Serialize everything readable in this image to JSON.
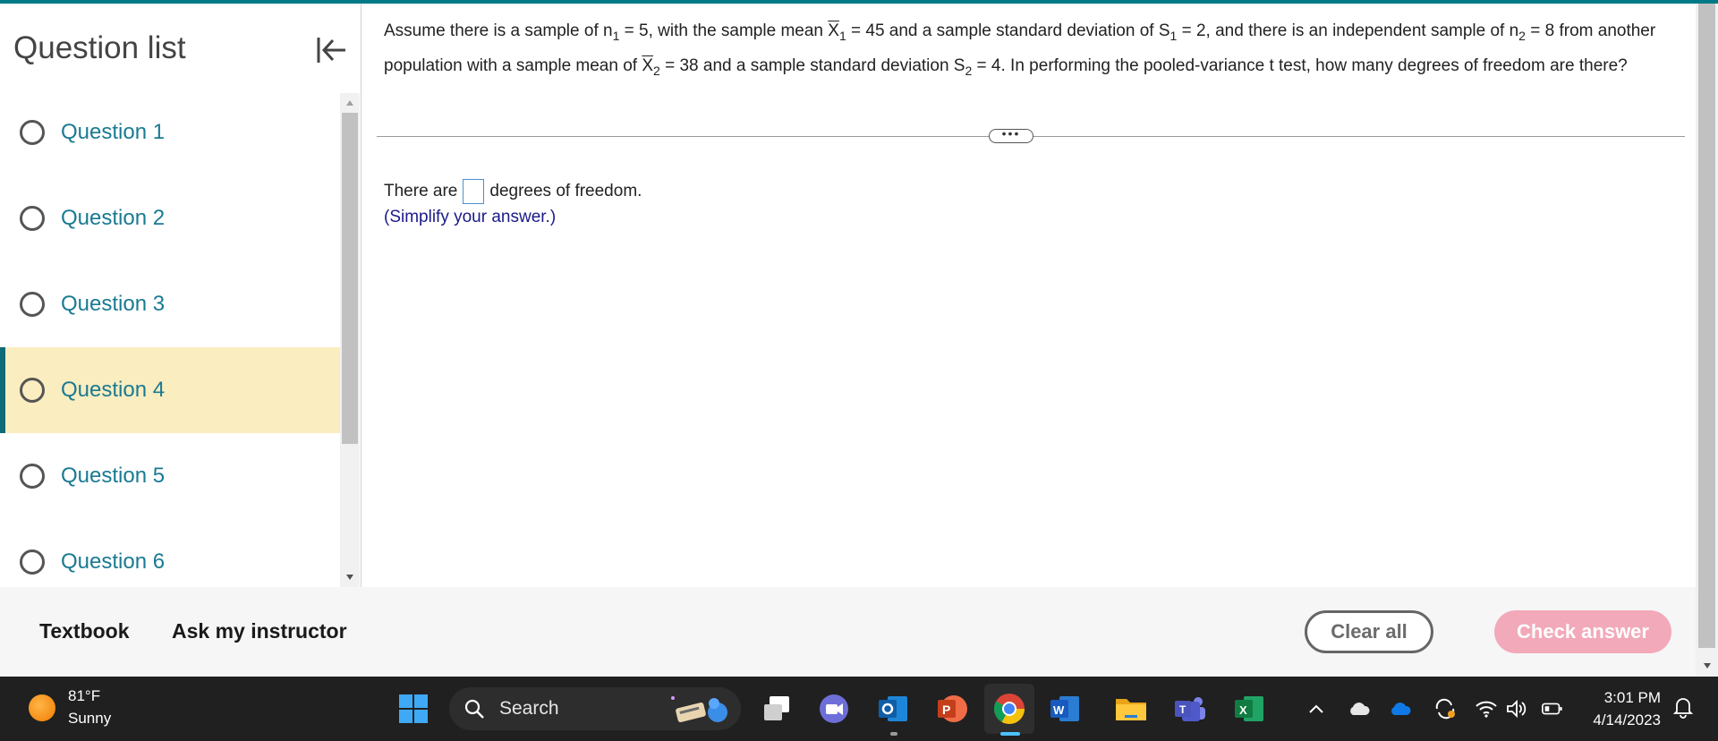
{
  "sidebar": {
    "title": "Question list",
    "items": [
      {
        "label": "Question 1"
      },
      {
        "label": "Question 2"
      },
      {
        "label": "Question 3"
      },
      {
        "label": "Question 4"
      },
      {
        "label": "Question 5"
      },
      {
        "label": "Question 6"
      }
    ],
    "active_index": 3
  },
  "question": {
    "p1": "Assume there is a sample of n",
    "s1": "1",
    "p2": " = 5, with the sample mean ",
    "x1": "X",
    "s2": "1",
    "p3": " = 45 and a sample standard deviation of S",
    "s3": "1",
    "p4": " = 2, and there is an independent sample of n",
    "s4": "2",
    "p5": " = 8 from another population with a sample mean of ",
    "x2": "X",
    "s5": "2",
    "p6": " = 38 and a sample standard deviation S",
    "s6": "2",
    "p7": " = 4. In performing the pooled-variance t test, how many degrees of freedom are there?",
    "more_label": "•••",
    "answer_before": "There are",
    "answer_after": "degrees of freedom.",
    "hint": "(Simplify your answer.)"
  },
  "footer": {
    "textbook": "Textbook",
    "ask": "Ask my instructor",
    "clear": "Clear all",
    "check": "Check answer"
  },
  "taskbar": {
    "temp": "81°F",
    "condition": "Sunny",
    "search_label": "Search",
    "time": "3:01 PM",
    "date": "4/14/2023",
    "apps": [
      "windows-start",
      "copilot-widget",
      "task-view",
      "chat",
      "outlook",
      "powerpoint",
      "chrome",
      "word",
      "file-explorer",
      "teams",
      "excel"
    ]
  },
  "colors": {
    "accent": "#007a87",
    "link": "#1a7a93",
    "active_bg": "#faedc0",
    "check_btn": "#f2a9b9",
    "hint": "#1a1a8a"
  }
}
